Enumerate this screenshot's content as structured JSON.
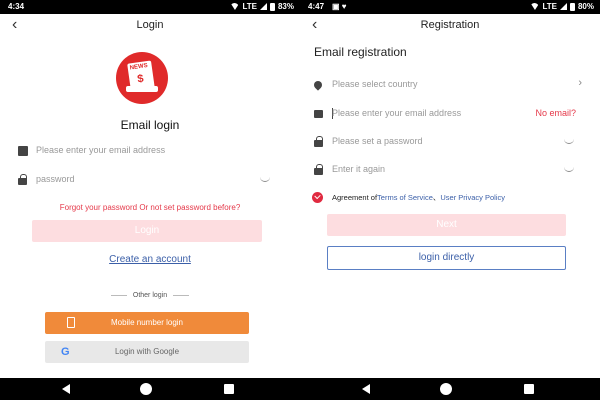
{
  "left": {
    "status_time": "4:34",
    "status_lte": "LTE",
    "status_battery": "83%",
    "title": "Login",
    "logo_text": "NEWS",
    "logo_symbol": "$",
    "heading": "Email login",
    "email_placeholder": "Please enter your email address",
    "password_placeholder": "password",
    "forgot_text": "Forgot your password Or not set password before?",
    "login_label": "Login",
    "create_label": "Create an account",
    "other_login_label": "Other login",
    "mobile_login_label": "Mobile number login",
    "google_login_label": "Login with Google",
    "google_glyph": "G"
  },
  "right": {
    "status_time": "4:47",
    "status_lte": "LTE",
    "status_battery": "80%",
    "title": "Registration",
    "heading": "Email registration",
    "country_placeholder": "Please select country",
    "email_placeholder": "Please enter your email address",
    "no_email_label": "No email?",
    "password_placeholder": "Please set a password",
    "confirm_placeholder": "Enter it again",
    "agreement_prefix": "Agreement of ",
    "terms_label": "Terms of Service",
    "separator": "、",
    "privacy_label": "User Privacy Policy",
    "next_label": "Next",
    "direct_label": "login directly"
  },
  "colors": {
    "accent_red": "#e02a2a",
    "link_blue": "#3b5fa8",
    "orange": "#f08a3a",
    "disabled_pink": "#fddde0"
  },
  "icons": [
    "mail-icon",
    "lock-icon",
    "location-icon",
    "eye-hidden-icon",
    "chevron-right-icon",
    "back-arrow-icon",
    "google-icon",
    "phone-icon"
  ]
}
